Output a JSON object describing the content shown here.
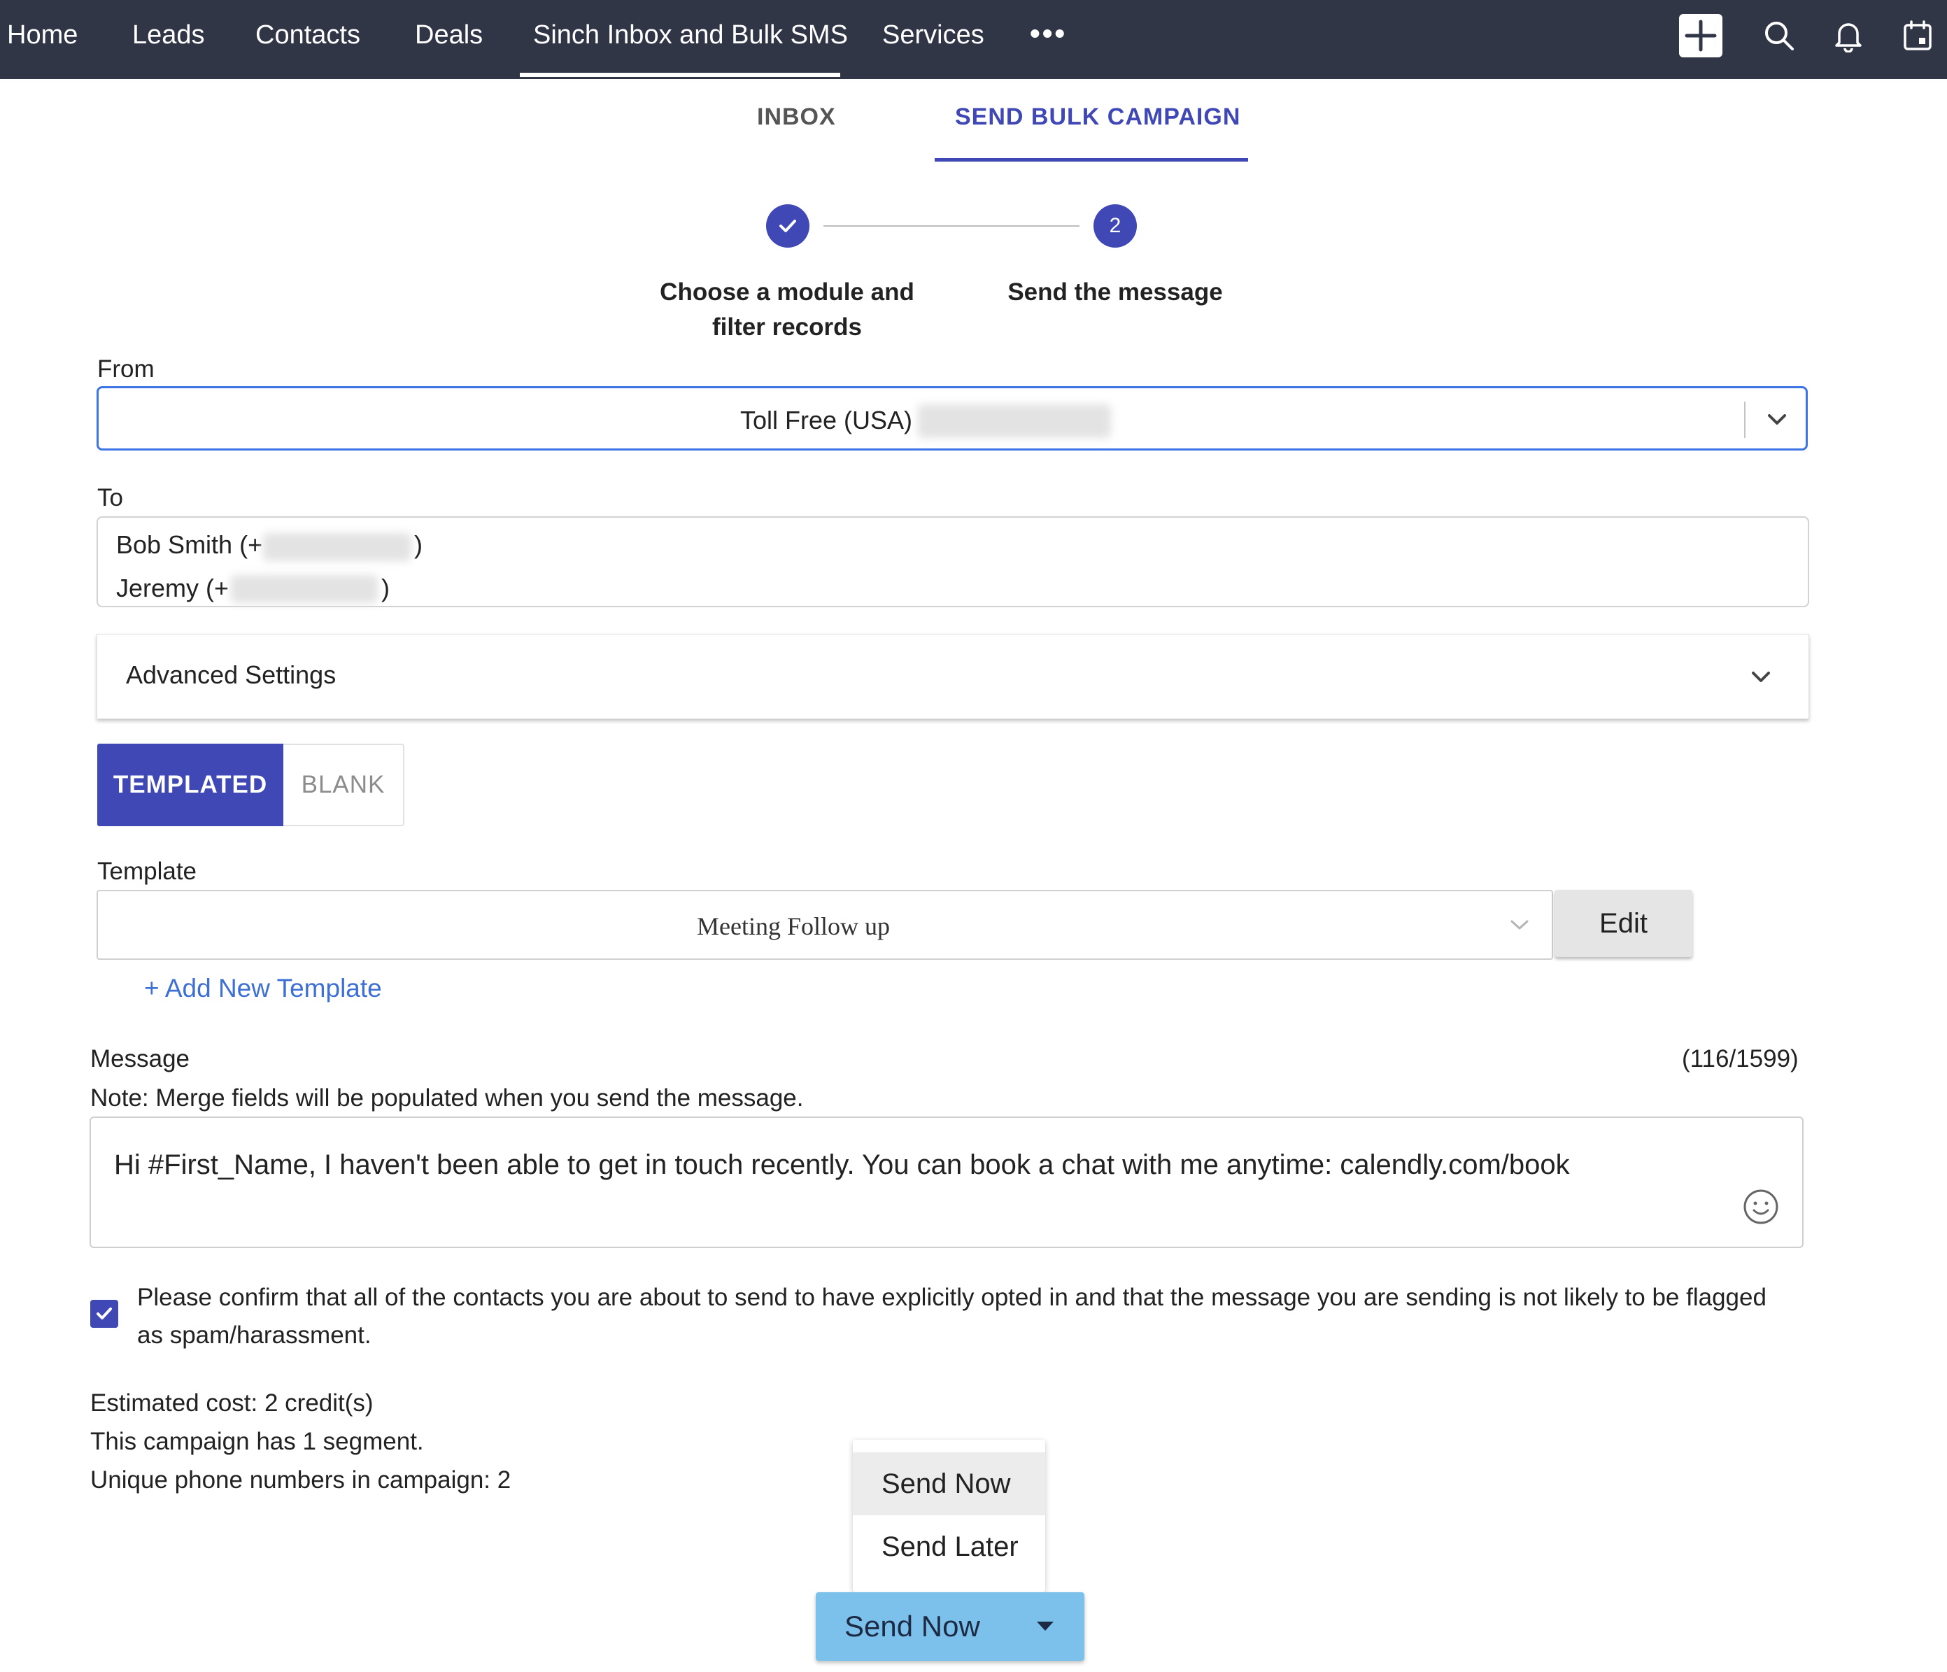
{
  "nav": {
    "items": [
      "Home",
      "Leads",
      "Contacts",
      "Deals",
      "Sinch Inbox and Bulk SMS",
      "Services"
    ],
    "active_index": 4,
    "more_icon": "more-horizontal-icon",
    "right_icons": [
      "plus-icon",
      "search-icon",
      "bell-icon",
      "calendar-icon"
    ]
  },
  "tabs": {
    "inbox": "INBOX",
    "send_bulk": "SEND BULK CAMPAIGN",
    "active": "SEND BULK CAMPAIGN"
  },
  "stepper": {
    "step1": {
      "label_line1": "Choose a module and",
      "label_line2": "filter records",
      "state": "completed",
      "icon": "check-icon"
    },
    "step2": {
      "number": "2",
      "label": "Send the message",
      "state": "active"
    }
  },
  "form": {
    "from_label": "From",
    "from_value": "Toll Free (USA)",
    "to_label": "To",
    "recipients": [
      {
        "name": "Bob Smith (+",
        "suffix": ")"
      },
      {
        "name": "Jeremy (+",
        "suffix": ")"
      }
    ],
    "advanced_settings": "Advanced Settings",
    "mode_templated": "TEMPLATED",
    "mode_blank": "BLANK",
    "mode_selected": "TEMPLATED",
    "template_label": "Template",
    "template_value": "Meeting Follow up",
    "edit_button": "Edit",
    "add_template": "+ Add New Template",
    "message_label": "Message",
    "message_count": "(116/1599)",
    "message_note": "Note: Merge fields will be populated when you send the message.",
    "message_text": "Hi #First_Name, I haven't been able to get in touch recently. You can book a chat with me anytime: calendly.com/book",
    "confirm_checked": true,
    "confirm_text": "Please confirm that all of the contacts you are about to send to have explicitly opted in and that the message you are sending is not likely to be flagged as spam/harassment.",
    "estimated_cost": "Estimated cost: 2 credit(s)",
    "segments": "This campaign has 1 segment.",
    "unique_numbers": "Unique phone numbers in campaign: 2"
  },
  "send": {
    "menu_items": [
      "Send Now",
      "Send Later"
    ],
    "highlighted_item": "Send Now",
    "button_label": "Send Now"
  },
  "colors": {
    "nav_bg": "#313647",
    "accent": "#3f48b4",
    "focus_border": "#3d75e6",
    "send_button": "#7cc1ec",
    "link": "#3d6fd4"
  }
}
